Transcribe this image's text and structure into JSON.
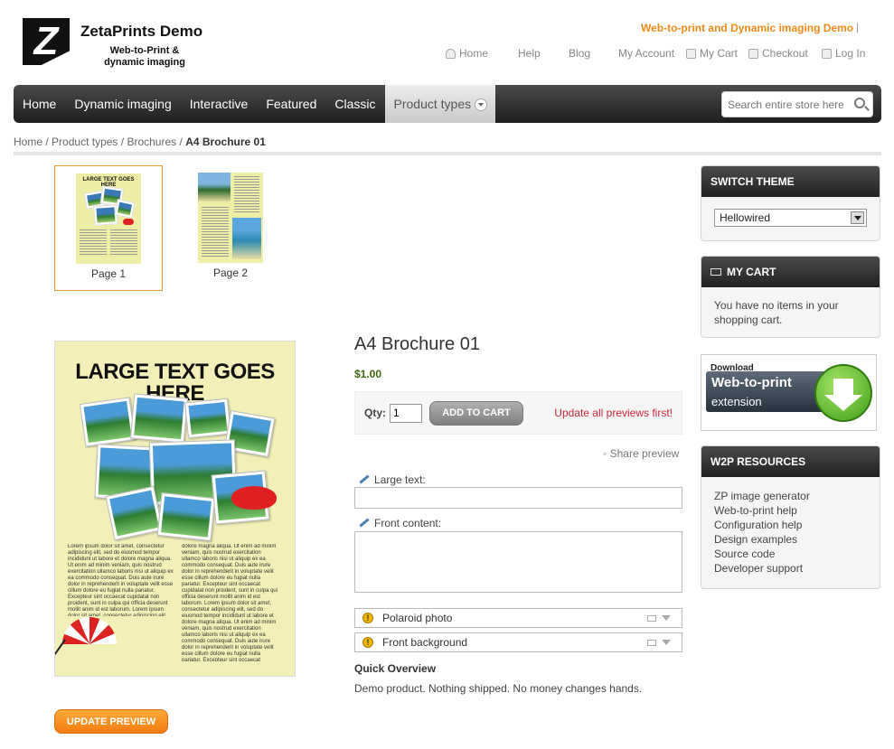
{
  "header": {
    "brand": "ZetaPrints Demo",
    "tagline_line1": "Web-to-Print &",
    "tagline_line2": "dynamic imaging",
    "promo": "Web-to-print and Dynamic imaging Demo",
    "promo_sep": "|",
    "links": {
      "home": "Home",
      "help": "Help",
      "blog": "Blog",
      "account": "My Account",
      "cart": "My Cart",
      "checkout": "Checkout",
      "login": "Log In"
    }
  },
  "nav": {
    "items": [
      "Home",
      "Dynamic imaging",
      "Interactive",
      "Featured",
      "Classic",
      "Product types"
    ],
    "search_placeholder": "Search entire store here..."
  },
  "breadcrumb": {
    "home": "Home",
    "product_types": "Product types",
    "brochures": "Brochures",
    "current": "A4 Brochure 01",
    "sep": "/"
  },
  "pages": [
    "Page 1",
    "Page 2"
  ],
  "preview": {
    "title": "LARGE TEXT GOES HERE",
    "thumb_title": "LARGE TEXT GOES HERE",
    "body_left": "Lorem ipsum dolor sit amet, consectetur adipiscing elit, sed do eiusmod tempor incididunt ut labore et dolore magna aliqua. Ut enim ad minim veniam, quis nostrud exercitation ullamco laboris nisi ut aliquip ex ea commodo consequat. Duis aute irure dolor in reprehenderit in voluptate velit esse cillum dolore eu fugiat nulla pariatur. Excepteur sint occaecat cupidatat non proident, sunt in culpa qui officia deserunt mollit anim id est laborum. Lorem ipsum dolor sit amet, consectetur adipiscing elit, sed do eiusmod tempor incididunt ut labore et",
    "body_right": "dolore magna aliqua. Ut enim ad minim veniam, quis nostrud exercitation ullamco laboris nisi ut aliquip ex ea commodo consequat. Duis aute irure dolor in reprehenderit in voluptate velit esse cillum dolore eu fugiat nulla pariatur. Excepteur sint occaecat cupidatat non proident, sunt in culpa qui officia deserunt mollit anim id est laborum. Lorem ipsum dolor sit amet, consectetur adipiscing elit, sed do eiusmod tempor incididunt ut labore et dolore magna aliqua. Ut enim ad minim veniam, quis nostrud exercitation ullamco laboris nisi ut aliquip ex ea commodo consequat. Duis aute irure dolor in reprehenderit in voluptate velit esse cillum dolore eu fugiat nulla pariatur. Excepteur sint occaecat"
  },
  "product": {
    "title": "A4 Brochure 01",
    "price": "$1.00",
    "qty_label": "Qty:",
    "qty_value": "1",
    "add_to_cart": "ADD TO CART",
    "warning": "Update all previews first!",
    "share": "Share preview",
    "field_large_text": "Large text:",
    "field_front_content": "Front content:",
    "image_fields": [
      "Polaroid photo",
      "Front background"
    ],
    "quick_overview_title": "Quick Overview",
    "quick_overview_text": "Demo product. Nothing shipped. No money changes hands.",
    "update_preview": "UPDATE PREVIEW"
  },
  "sidebar": {
    "switch_theme_title": "SWITCH THEME",
    "theme_value": "Hellowired",
    "cart_title": "MY CART",
    "cart_text": "You have no items in your shopping cart.",
    "download_small": "Download",
    "download_big": "Web-to-print",
    "download_ext": "extension",
    "resources_title": "W2P RESOURCES",
    "resources": [
      "ZP image generator",
      "Web-to-print help",
      "Configuration help",
      "Design examples",
      "Source code",
      "Developer support"
    ]
  }
}
